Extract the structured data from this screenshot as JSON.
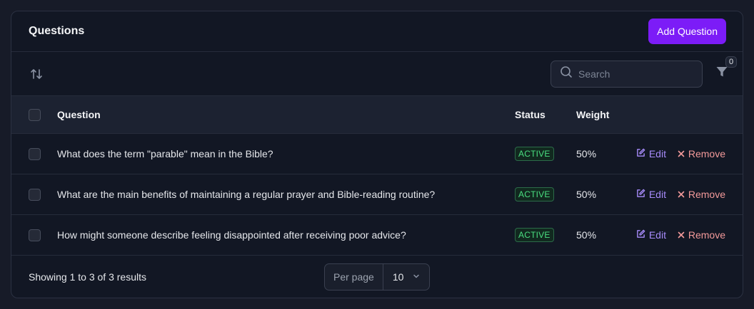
{
  "header": {
    "title": "Questions",
    "add_button": "Add Question"
  },
  "toolbar": {
    "search_placeholder": "Search",
    "filter_count": "0"
  },
  "table": {
    "columns": {
      "question": "Question",
      "status": "Status",
      "weight": "Weight"
    },
    "rows": [
      {
        "question": "What does the term \"parable\" mean in the Bible?",
        "status": "ACTIVE",
        "weight": "50%",
        "edit": "Edit",
        "remove": "Remove"
      },
      {
        "question": "What are the main benefits of maintaining a regular prayer and Bible-reading routine?",
        "status": "ACTIVE",
        "weight": "50%",
        "edit": "Edit",
        "remove": "Remove"
      },
      {
        "question": "How might someone describe feeling disappointed after receiving poor advice?",
        "status": "ACTIVE",
        "weight": "50%",
        "edit": "Edit",
        "remove": "Remove"
      }
    ]
  },
  "footer": {
    "summary": "Showing 1 to 3 of 3 results",
    "per_page_label": "Per page",
    "per_page_value": "10"
  },
  "colors": {
    "accent": "#7c1cf7",
    "status_active": "#4ade80",
    "edit": "#a78bfa",
    "remove": "#f39a9a"
  },
  "icons": [
    "sort-icon",
    "search-icon",
    "filter-icon",
    "edit-icon",
    "close-icon",
    "chevron-down-icon"
  ]
}
